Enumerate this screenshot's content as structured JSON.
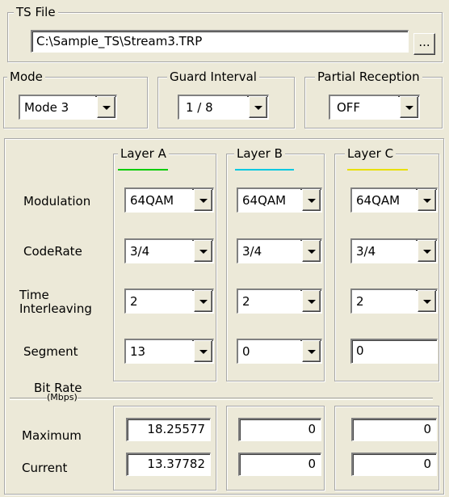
{
  "ts_file": {
    "title": "TS File",
    "path": "C:\\Sample_TS\\Stream3.TRP",
    "browse_label": "..."
  },
  "mode": {
    "title": "Mode",
    "value": "Mode 3"
  },
  "guard_interval": {
    "title": "Guard Interval",
    "value": "1 / 8"
  },
  "partial_reception": {
    "title": "Partial Reception",
    "value": "OFF"
  },
  "layers": {
    "a": {
      "title": "Layer A",
      "color": "#00cc00",
      "modulation": "64QAM",
      "code_rate": "3/4",
      "time_interleaving": "2",
      "segment": "13",
      "max": "18.25577",
      "current": "13.37782"
    },
    "b": {
      "title": "Layer B",
      "color": "#00c8e0",
      "modulation": "64QAM",
      "code_rate": "3/4",
      "time_interleaving": "2",
      "segment": "0",
      "max": "0",
      "current": "0"
    },
    "c": {
      "title": "Layer C",
      "color": "#e8e000",
      "modulation": "64QAM",
      "code_rate": "3/4",
      "time_interleaving": "2",
      "segment": "0",
      "max": "0",
      "current": "0"
    }
  },
  "row_labels": {
    "modulation": "Modulation",
    "code_rate": "CodeRate",
    "time_line1": "Time",
    "time_line2": "Interleaving",
    "segment": "Segment"
  },
  "bit_rate": {
    "title": "Bit Rate",
    "unit": "(Mbps)",
    "maximum": "Maximum",
    "current": "Current"
  }
}
